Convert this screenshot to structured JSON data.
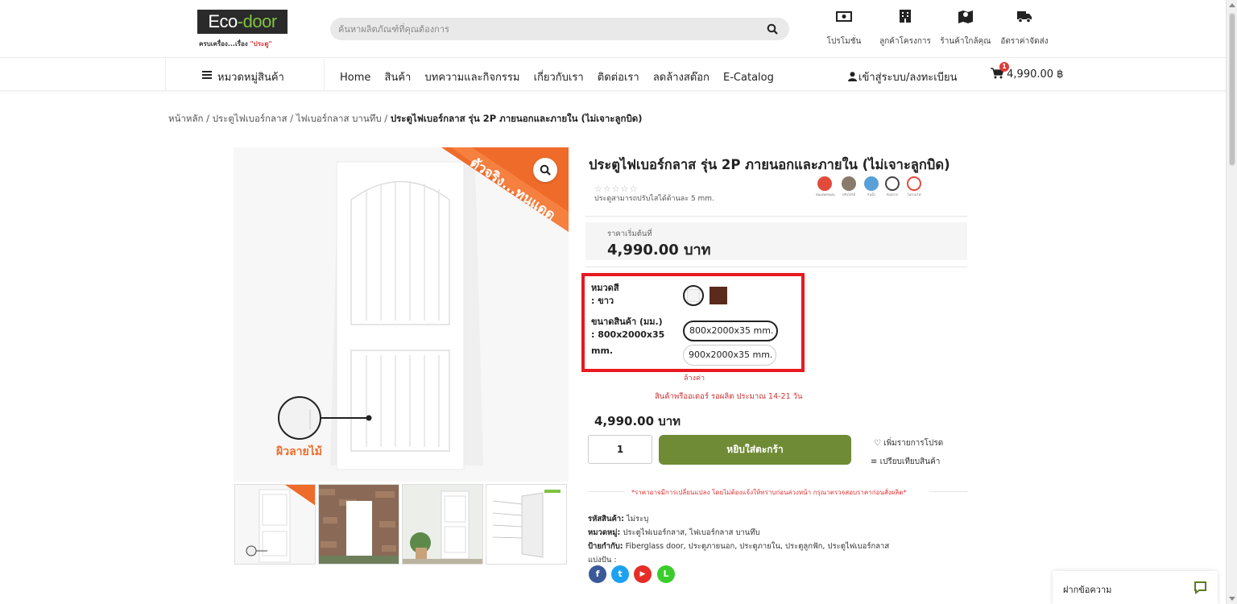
{
  "header": {
    "logo_text_eco": "Eco",
    "logo_text_door": "-door",
    "logo_tagline": "ครบเครื่อง...เรื่อง",
    "logo_tagline_accent": "\"ประตู\"",
    "search_placeholder": "ค้นหาผลิตภัณฑ์ที่คุณต้องการ",
    "top_links": [
      {
        "label": "โปรโมชั่น",
        "icon": "money-icon"
      },
      {
        "label": "ลูกค้าโครงการ",
        "icon": "building-icon"
      },
      {
        "label": "ร้านค้าใกล้คุณ",
        "icon": "map-icon"
      },
      {
        "label": "อัตราค่าจัดส่ง",
        "icon": "truck-icon"
      }
    ]
  },
  "nav": {
    "category_label": "หมวดหมู่สินค้า",
    "menu": [
      "Home",
      "สินค้า",
      "บทความและกิจกรรม",
      "เกี่ยวกับเรา",
      "ติดต่อเรา",
      "ลดล้างสต๊อก",
      "E-Catalog"
    ],
    "login_label": "เข้าสู่ระบบ/ลงทะเบียน",
    "cart_count": "1",
    "cart_total": "4,990.00 ฿"
  },
  "breadcrumb": {
    "items": [
      "หน้าหลัก",
      "ประตูไฟเบอร์กลาส",
      "ไฟเบอร์กลาส บานทึบ"
    ],
    "separator": " / ",
    "current": "ประตูไฟเบอร์กลาส รุ่น 2P ภายนอกและภายใน (ไม่เจาะลูกบิด)"
  },
  "gallery": {
    "ribbon_text": "ตัวจริง...ทนแดด",
    "texture_label": "ผิวลายไม้",
    "thumb_count": 4
  },
  "product": {
    "title": "ประตูไฟเบอร์กลาส รุ่น 2P ภายนอกและภายใน (ไม่เจาะลูกบิด)",
    "stars": "☆☆☆☆☆",
    "adjust_note": "ประตูสามารถปรับไสได้ด้านละ 5 mm.",
    "features": [
      {
        "label": "ทนแดดทนฝน",
        "color": "#e24b3b"
      },
      {
        "label": "ปรับไสได้",
        "color": "#8a7a6a"
      },
      {
        "label": "กันน้ำ",
        "color": "#5aa0d8"
      },
      {
        "label": "กันปลวก",
        "color": "#444444"
      },
      {
        "label": "ไม่ลามไฟ",
        "color": "#e24b3b"
      }
    ],
    "price_label": "ราคาเริ่มต้นที่",
    "price_value": "4,990.00 บาท",
    "color_option_label": "หมวดสี",
    "color_option_value": ": ขาว",
    "size_option_label": "ขนาดสินค้า (มม.)",
    "size_option_value": ": 800x2000x35",
    "size_option_unit": "mm.",
    "sizes": [
      "800x2000x35 mm.",
      "900x2000x35 mm."
    ],
    "clear_label": "ล้างค่า",
    "backorder_note": "สินค้าพรีออเดอร์ รอผลิต ประมาณ 14-21 วัน",
    "variant_price": "4,990.00 บาท",
    "quantity": "1",
    "add_to_cart_label": "หยิบใส่ตะกร้า",
    "wishlist_label": "เพิ่มรายการโปรด",
    "compare_label": "เปรียบเทียบสินค้า",
    "price_notice": "*ราคาอาจมีการเปลี่ยนแปลง โดยไม่ต้องแจ้งให้ทราบก่อนล่วงหน้า กรุณาตรวจสอบราคาก่อนสั่งผลิต*",
    "sku_label": "รหัสสินค้า:",
    "sku_value": "ไม่ระบุ",
    "category_label": "หมวดหมู่:",
    "category_value": "ประตูไฟเบอร์กลาส, ไฟเบอร์กลาส บานทึบ",
    "tags_label": "ป้ายกำกับ:",
    "tags_value": "Fiberglass door, ประตูภายนอก, ประตูภายใน, ประตูลูกฟัก, ประตูไฟเบอร์กลาส",
    "share_label": "แบ่งปัน :"
  },
  "share": [
    {
      "name": "facebook",
      "glyph": "f",
      "color": "#3b5998"
    },
    {
      "name": "twitter",
      "glyph": "t",
      "color": "#1da1f2"
    },
    {
      "name": "youtube",
      "glyph": "▶",
      "color": "#e52d27"
    },
    {
      "name": "line",
      "glyph": "L",
      "color": "#3acc2b"
    }
  ],
  "chat": {
    "label": "ฝากข้อความ"
  }
}
